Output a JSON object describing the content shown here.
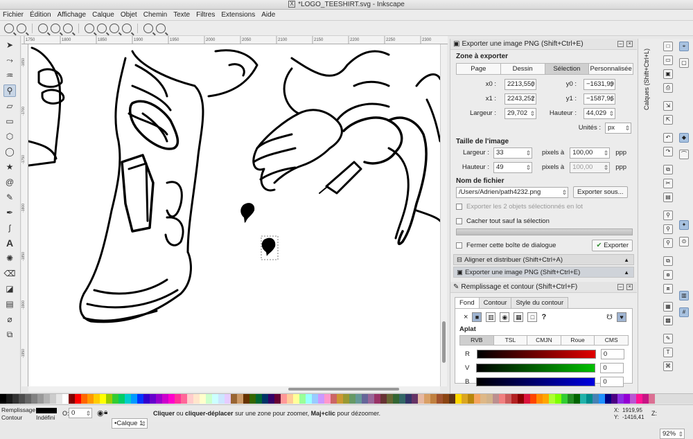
{
  "window": {
    "title": "*LOGO_TEESHIRT.svg - Inkscape"
  },
  "menu": [
    "Fichier",
    "Édition",
    "Affichage",
    "Calque",
    "Objet",
    "Chemin",
    "Texte",
    "Filtres",
    "Extensions",
    "Aide"
  ],
  "ruler": {
    "h_ticks": [
      "1750",
      "1800",
      "1850",
      "1900",
      "1950",
      "2000",
      "2050",
      "2100",
      "2150",
      "2200",
      "2250",
      "2300"
    ],
    "v_ticks": [
      "-1650",
      "-1700",
      "-1750",
      "-1800",
      "-1850",
      "-1900",
      "-1950"
    ]
  },
  "export_png": {
    "title": "Exporter une image PNG (Shift+Ctrl+E)",
    "zone_title": "Zone à exporter",
    "zone_buttons": [
      "Page",
      "Dessin",
      "Sélection",
      "Personnalisée"
    ],
    "zone_selected": "Sélection",
    "x0_label": "x0 :",
    "x0": "2213,550",
    "y0_label": "y0 :",
    "y0": "−1631,99",
    "x1_label": "x1 :",
    "x1": "2243,252",
    "y1_label": "y1 :",
    "y1": "−1587,96",
    "largeur_label": "Largeur :",
    "largeur": "29,702",
    "hauteur_label": "Hauteur :",
    "hauteur": "44,029",
    "units_label": "Unités :",
    "units": "px",
    "image_size_title": "Taille de l'image",
    "img_w_label": "Largeur :",
    "img_w": "33",
    "px_at": "pixels à",
    "dpi": "100,00",
    "ppp": "ppp",
    "img_h_label": "Hauteur :",
    "img_h": "49",
    "dpi_h": "100,00",
    "filename_title": "Nom de fichier",
    "filename": "/Users/Adrien/path4232.png",
    "export_as": "Exporter sous...",
    "batch": "Exporter les 2 objets sélectionnés en lot",
    "hide": "Cacher tout sauf la sélection",
    "close_dialog": "Fermer cette boîte de dialogue",
    "export_btn": "Exporter"
  },
  "collapsed_panels": [
    "Aligner et distribuer (Shift+Ctrl+A)",
    "Exporter une image PNG (Shift+Ctrl+E)"
  ],
  "fill_stroke": {
    "title": "Remplissage et contour (Shift+Ctrl+F)",
    "tabs": [
      "Fond",
      "Contour",
      "Style du contour"
    ],
    "flat_label": "Aplat",
    "modes": [
      "RVB",
      "TSL",
      "CMJN",
      "Roue",
      "CMS"
    ],
    "channels": [
      {
        "label": "R",
        "value": "0",
        "color": "#e00000"
      },
      {
        "label": "V",
        "value": "0",
        "color": "#00c000"
      },
      {
        "label": "B",
        "value": "0",
        "color": "#0000e0"
      }
    ]
  },
  "layers_tab": "Calques (Shift+Ctrl+L)",
  "status": {
    "fill_label": "Remplissage",
    "stroke_label": "Contour",
    "stroke_value": "Indéfini",
    "opacity_label": "O:",
    "opacity": "0",
    "layer": "•Calque 1",
    "message_b1": "Cliquer",
    "message_m1": " ou ",
    "message_b2": "cliquer-déplacer",
    "message_m2": " sur une zone pour zoomer, ",
    "message_b3": "Maj+clic",
    "message_m3": " pour dézoomer.",
    "x_label": "X:",
    "x": "1919,95",
    "y_label": "Y:",
    "y": "-1416,41",
    "z_label": "Z:",
    "zoom": "92%"
  }
}
